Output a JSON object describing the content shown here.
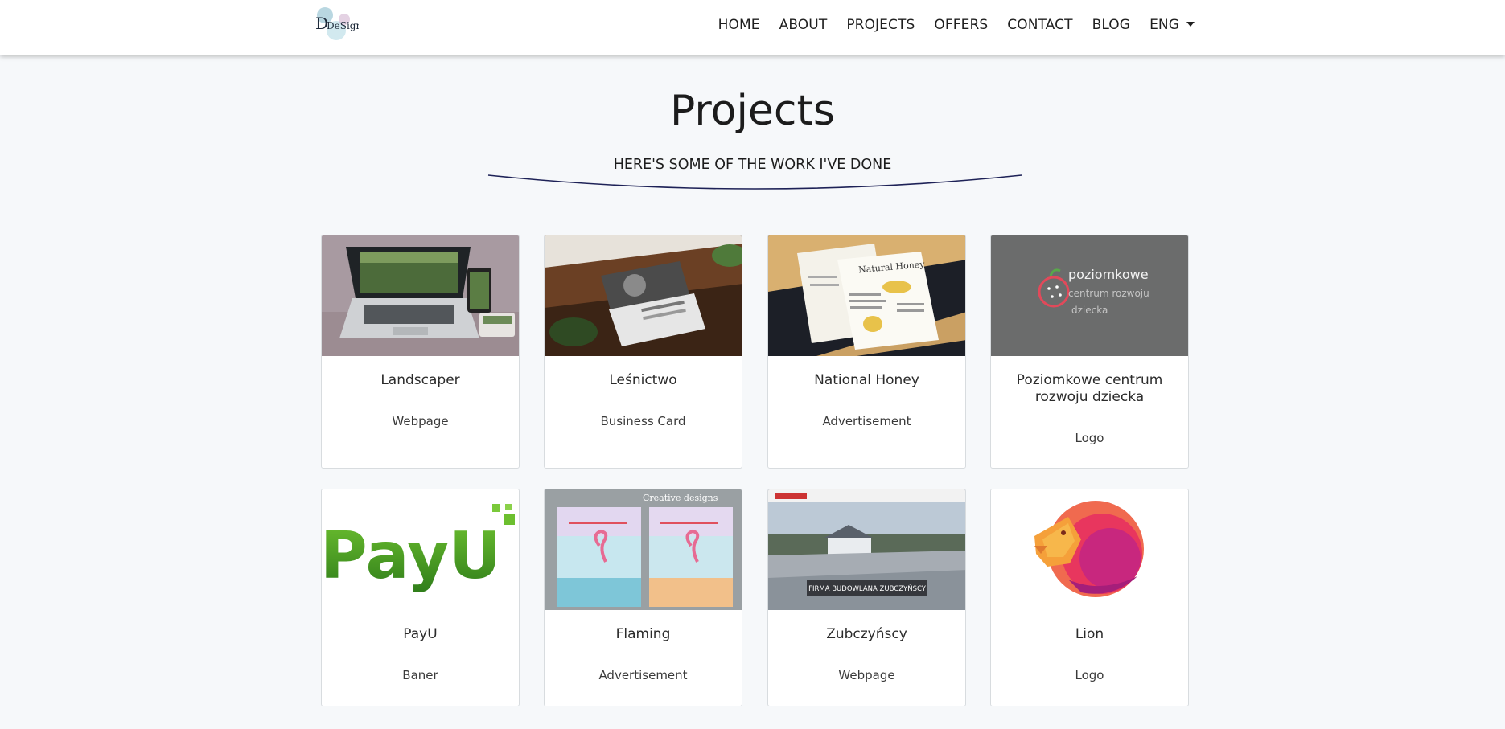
{
  "brand": {
    "logo_text": "DeSign"
  },
  "nav": {
    "items": [
      "HOME",
      "ABOUT",
      "PROJECTS",
      "OFFERS",
      "CONTACT",
      "BLOG"
    ],
    "language": "ENG"
  },
  "header": {
    "title": "Projects",
    "subtitle": "HERE'S SOME OF THE WORK I'VE DONE"
  },
  "projects": [
    {
      "title": "Landscaper",
      "category": "Webpage"
    },
    {
      "title": "Leśnictwo",
      "category": "Business Card"
    },
    {
      "title": "National Honey",
      "category": "Advertisement",
      "image_text": [
        "Natural Honey"
      ]
    },
    {
      "title": "Poziomkowe centrum rozwoju dziecka",
      "category": "Logo",
      "image_text": [
        "poziomkowe",
        "centrum rozwoju",
        "dziecka"
      ]
    },
    {
      "title": "PayU",
      "category": "Baner",
      "image_text": [
        "PayU"
      ]
    },
    {
      "title": "Flaming",
      "category": "Advertisement",
      "image_text": [
        "Creative designs"
      ]
    },
    {
      "title": "Zubczyńscy",
      "category": "Webpage",
      "image_text": [
        "FIRMA BUDOWLANA ZUBCZYŃSCY"
      ]
    },
    {
      "title": "Lion",
      "category": "Logo"
    }
  ],
  "colors": {
    "background": "#f6f8fa",
    "curve": "#1e2257",
    "payu_green": "#56a824",
    "lion_pink": "#e8365e"
  }
}
